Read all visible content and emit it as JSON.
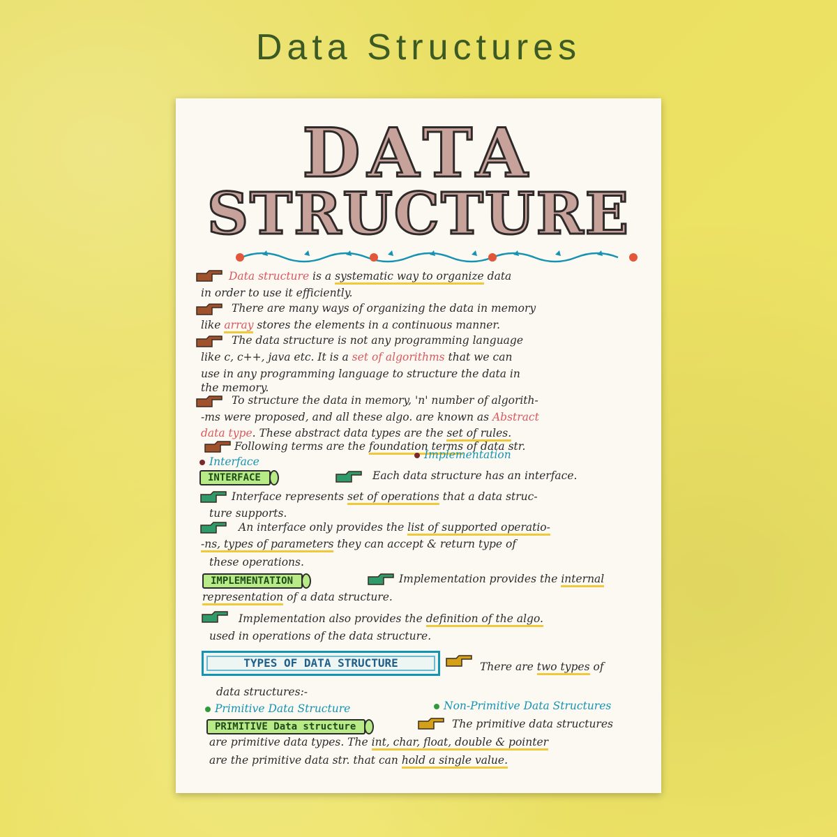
{
  "page_title": "Data Structures",
  "sheet": {
    "heading_line1": "DATA",
    "heading_line2": "STRUCTURE",
    "paragraphs": [
      [
        "Data structure",
        " is a ",
        "systematic",
        " way ",
        "to organize",
        " data"
      ],
      [
        "in order to use it efficiently."
      ],
      [
        "There are many ways of organizing the data in memory"
      ],
      [
        "like ",
        "array",
        " stores the elements in a continuous manner."
      ],
      [
        "The data structure is not any programming language"
      ],
      [
        "like c, c++, java etc. It is a ",
        "set of algorithms",
        " that we can"
      ],
      [
        "use in any programming language to structure the data in"
      ],
      [
        "the memory."
      ],
      [
        "To structure the data in memory, 'n' number of algorith-"
      ],
      [
        "-ms were proposed, and all these algo. are known as ",
        "Abstract"
      ],
      [
        "data type",
        ". These abstract data types are the ",
        "set of rules."
      ],
      [
        "Following terms are the ",
        "foundation terms",
        " of data str."
      ]
    ],
    "bullets_terms": [
      "Interface",
      "Implementation"
    ],
    "interface_label": "INTERFACE",
    "interface_lines": [
      "Each data structure has an interface.",
      "Interface represents",
      "set of operations",
      "that a data struc-",
      "ture supports.",
      "An interface only provides the",
      "list of supported operatio-",
      "-ns, types of parameters",
      "they can accept & return type of",
      "these operations."
    ],
    "implementation_label": "IMPLEMENTATION",
    "implementation_lines": [
      "Implementation provides the",
      "internal",
      "representation",
      "of a data structure.",
      "Implementation also provides the",
      "definition of the algo.",
      "used in operations of the data structure."
    ],
    "types_label": "TYPES OF DATA STRUCTURE",
    "types_lines": [
      "There are",
      "two types",
      "of",
      "data structures:-"
    ],
    "types_bullets": [
      "Primitive Data Structure",
      "Non-Primitive Data Structures"
    ],
    "primitive_label": "PRIMITIVE Data structure",
    "primitive_lines": [
      "The primitive data structures",
      "are primitive data types. The",
      "int, char, float, double & pointer",
      "are the primitive data str. that can",
      "hold a single value."
    ]
  },
  "colors": {
    "background": "#efe460",
    "title": "#3b5a24",
    "accent_red": "#d9585f",
    "accent_blue": "#1593b2",
    "highlight": "#f0c93a",
    "pill_green": "#b8ea88"
  },
  "icons": [
    "pointing-hand-icon",
    "flower-icon",
    "vine-divider-icon"
  ]
}
